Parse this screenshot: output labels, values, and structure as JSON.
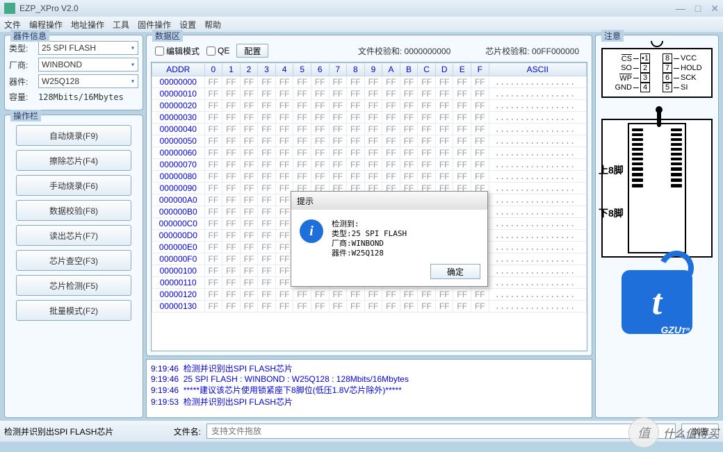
{
  "title": "EZP_XPro V2.0",
  "menus": [
    "文件",
    "编程操作",
    "地址操作",
    "工具",
    "固件操作",
    "设置",
    "帮助"
  ],
  "dev_info": {
    "group": "器件信息",
    "type_lbl": "类型:",
    "type_val": "25 SPI FLASH",
    "vendor_lbl": "厂商:",
    "vendor_val": "WINBOND",
    "part_lbl": "器件:",
    "part_val": "W25Q128",
    "cap_lbl": "容量:",
    "cap_val": "128Mbits/16Mbytes"
  },
  "ops": {
    "group": "操作栏",
    "items": [
      "自动烧录(F9)",
      "擦除芯片(F4)",
      "手动烧录(F6)",
      "数据校验(F8)",
      "读出芯片(F7)",
      "芯片查空(F3)",
      "芯片检测(F5)",
      "批量模式(F2)"
    ]
  },
  "data": {
    "group": "数据区",
    "edit_mode": "编辑模式",
    "qe": "QE",
    "config": "配置",
    "file_sum_lbl": "文件校验和: ",
    "file_sum_val": "0000000000",
    "chip_sum_lbl": "芯片校验和: ",
    "chip_sum_val": "00FF000000",
    "hdr_addr": "ADDR",
    "hdr_hex": [
      "0",
      "1",
      "2",
      "3",
      "4",
      "5",
      "6",
      "7",
      "8",
      "9",
      "A",
      "B",
      "C",
      "D",
      "E",
      "F"
    ],
    "hdr_asc": "ASCII",
    "rows": [
      "00000000",
      "00000010",
      "00000020",
      "00000030",
      "00000040",
      "00000050",
      "00000060",
      "00000070",
      "00000080",
      "00000090",
      "000000A0",
      "000000B0",
      "000000C0",
      "000000D0",
      "000000E0",
      "000000F0",
      "00000100",
      "00000110",
      "00000120",
      "00000130"
    ],
    "cell": "FF",
    "asc": "................"
  },
  "log": [
    "9:19:46  检测并识别出SPI FLASH芯片",
    "9:19:46  25 SPI FLASH : WINBOND : W25Q128 : 128Mbits/16Mbytes",
    "9:19:46  *****建议该芯片使用锁紧座下8脚位(低压1.8V芯片除外)*****",
    "9:19:53  检测并识别出SPI FLASH芯片"
  ],
  "status": "检测并识别出SPI FLASH芯片",
  "fname_lbl": "文件名:",
  "fname_ph": "支持文件拖放",
  "browse": "浏览",
  "notes": {
    "group": "注意",
    "pins_l": [
      "CS",
      "SO",
      "WP",
      "GND"
    ],
    "pins_l_ov": [
      true,
      false,
      true,
      false
    ],
    "pins_r": [
      "VCC",
      "HOLD",
      "SCK",
      "SI"
    ],
    "n_l": [
      "•1",
      "2",
      "3",
      "4"
    ],
    "n_r": [
      "8",
      "7",
      "6",
      "5"
    ],
    "up8": "上8脚",
    "dn8": "下8脚",
    "gz": "GZUᴛⁿ"
  },
  "dialog": {
    "title": "提示",
    "msg": "检测到:\n类型:25 SPI FLASH\n厂商:WINBOND\n器件:W25Q128",
    "ok": "确定"
  },
  "watermark": "什么值得买"
}
